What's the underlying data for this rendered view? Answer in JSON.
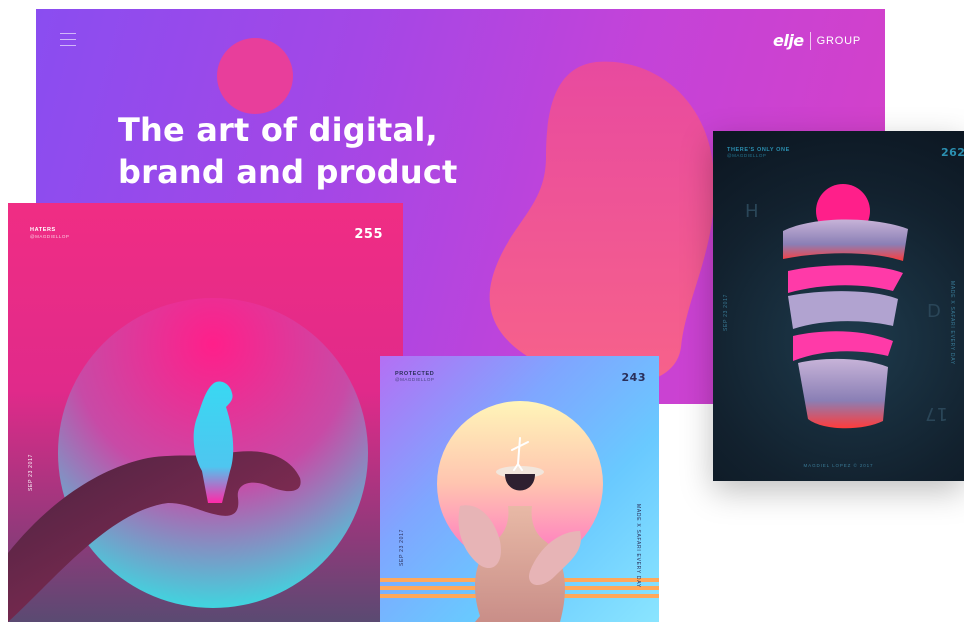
{
  "hero": {
    "headline_line1": "The art of digital,",
    "headline_line2": "brand and product",
    "menu_icon": "hamburger-icon",
    "logo": {
      "mark": "elje",
      "group": "GROUP"
    },
    "colors": {
      "gradient_start": "#8a4df0",
      "gradient_end": "#d640c7",
      "sun": "#e83e9b",
      "blob": "#f05a90"
    }
  },
  "cards": [
    {
      "id": "haters",
      "title": "HATERS",
      "handle": "@MAGDIELLOP",
      "number": "255",
      "date": "SEP 23 2017",
      "colors": {
        "top": "#f02d84",
        "bottom": "#5a4a72",
        "circle": "#ff1f8a",
        "bird": "#3ad6f0"
      }
    },
    {
      "id": "protected",
      "title": "PROTECTED",
      "handle": "@MAGDIELLOP",
      "number": "243",
      "side_left": "SEP 23 2017",
      "side_right": "MADE X SAFARI EVERY DAY",
      "colors": {
        "bg": "#7fa6ff",
        "sun_top": "#fff3b0",
        "sun_bottom": "#ff6fc4"
      }
    },
    {
      "id": "only-one",
      "title": "THERE'S ONLY ONE",
      "handle": "@MAGDIELLOP",
      "number": "262",
      "side_left": "SEP 23 2017",
      "side_right": "MADE X SAFARI EVERY DAY",
      "footer": "MAGDIEL LOPEZ © 2017",
      "glyph_h": "H",
      "glyph_d": "D",
      "glyph_17": "17",
      "colors": {
        "bg": "#12212e",
        "sun": "#ff1f8a",
        "accent": "#2b8fb0"
      }
    }
  ]
}
